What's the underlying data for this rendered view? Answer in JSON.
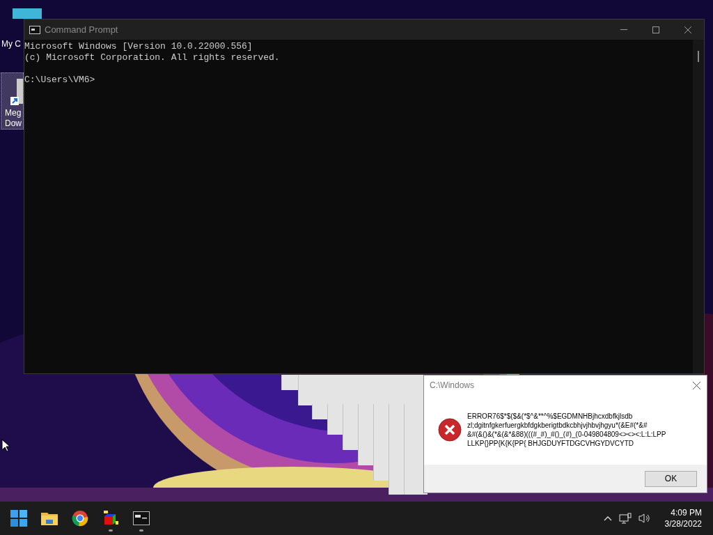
{
  "desktop_icons": [
    {
      "label_lines": [
        "My C"
      ]
    },
    {
      "label_lines": [
        "Meg",
        "Dow"
      ],
      "selected": true
    }
  ],
  "console_window": {
    "title": "Command Prompt",
    "lines": [
      "Microsoft Windows [Version 10.0.22000.556]",
      "(c) Microsoft Corporation. All rights reserved."
    ],
    "prompt": "C:\\Users\\VM6>"
  },
  "error_dialog": {
    "title": "C:\\Windows",
    "message_lines": [
      "ERROR76$*$($&(*$^&**^%$EGDMNHBjhcxdbfkjlsdb",
      "zl;dgitnfgkerfuergkbfdgkberigtbdkcbhjvjhbvjhgyu*(&E#(*&#",
      "&#(&()&(*&(&*&88)(((#_#)_#()_(#)_(0-049804809<><><:L:L:LPP",
      "LLKP{}PP{K{K{PP{ BHJGDUYFTDGCVHGYDVCYTD"
    ],
    "button": "OK"
  },
  "taskbar": {
    "apps": [
      {
        "kind": "start",
        "running": false
      },
      {
        "kind": "folder",
        "running": false
      },
      {
        "kind": "browser",
        "running": false
      },
      {
        "kind": "cube",
        "running": true
      },
      {
        "kind": "terminal",
        "running": true
      }
    ],
    "time": "4:09 PM",
    "date": "3/28/2022"
  }
}
